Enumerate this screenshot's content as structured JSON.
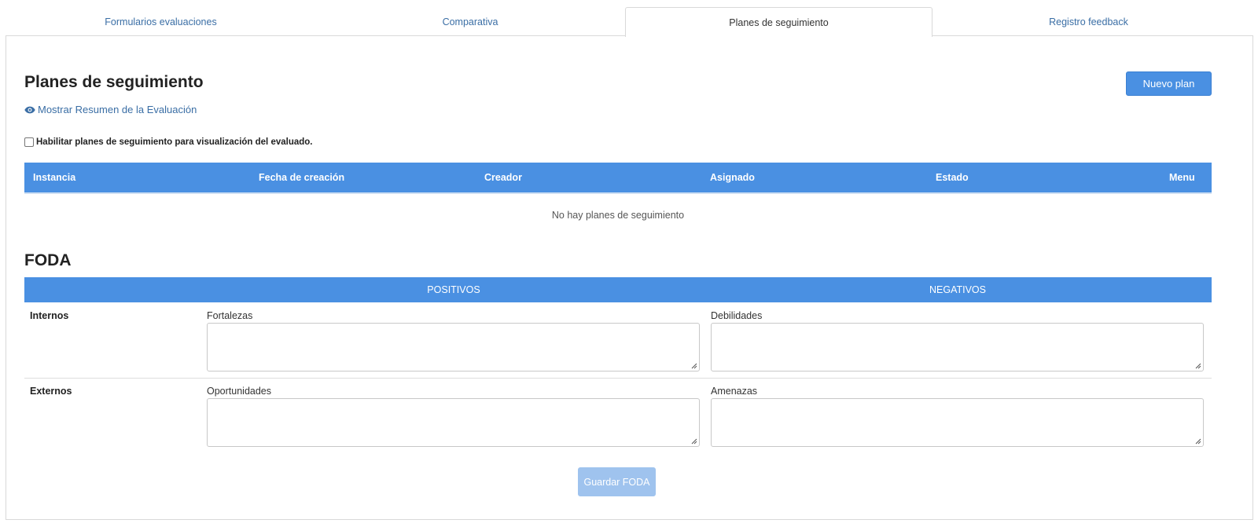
{
  "tabs": [
    {
      "label": "Formularios evaluaciones",
      "active": false
    },
    {
      "label": "Comparativa",
      "active": false
    },
    {
      "label": "Planes de seguimiento",
      "active": true
    },
    {
      "label": "Registro feedback",
      "active": false
    }
  ],
  "page": {
    "title": "Planes de seguimiento",
    "summary_link": "Mostrar Resumen de la Evaluación",
    "new_plan_button": "Nuevo plan",
    "enable_checkbox_label": "Habilitar planes de seguimiento para visualización del evaluado.",
    "enable_checked": false
  },
  "plans_table": {
    "columns": [
      "Instancia",
      "Fecha de creación",
      "Creador",
      "Asignado",
      "Estado",
      "Menu"
    ],
    "rows": [],
    "empty_message": "No hay planes de seguimiento"
  },
  "foda": {
    "title": "FODA",
    "columns": [
      "POSITIVOS",
      "NEGATIVOS"
    ],
    "rows": [
      {
        "label": "Internos",
        "fields": [
          {
            "label": "Fortalezas",
            "value": ""
          },
          {
            "label": "Debilidades",
            "value": ""
          }
        ]
      },
      {
        "label": "Externos",
        "fields": [
          {
            "label": "Oportunidades",
            "value": ""
          },
          {
            "label": "Amenazas",
            "value": ""
          }
        ]
      }
    ],
    "save_button": "Guardar FODA"
  },
  "colors": {
    "accent": "#4a90e2",
    "link": "#3a6ea5",
    "disabled_button": "#9fc3ee"
  },
  "icons": {
    "summary_link": "eye-icon",
    "textarea_resize": "resize-grip-icon"
  }
}
